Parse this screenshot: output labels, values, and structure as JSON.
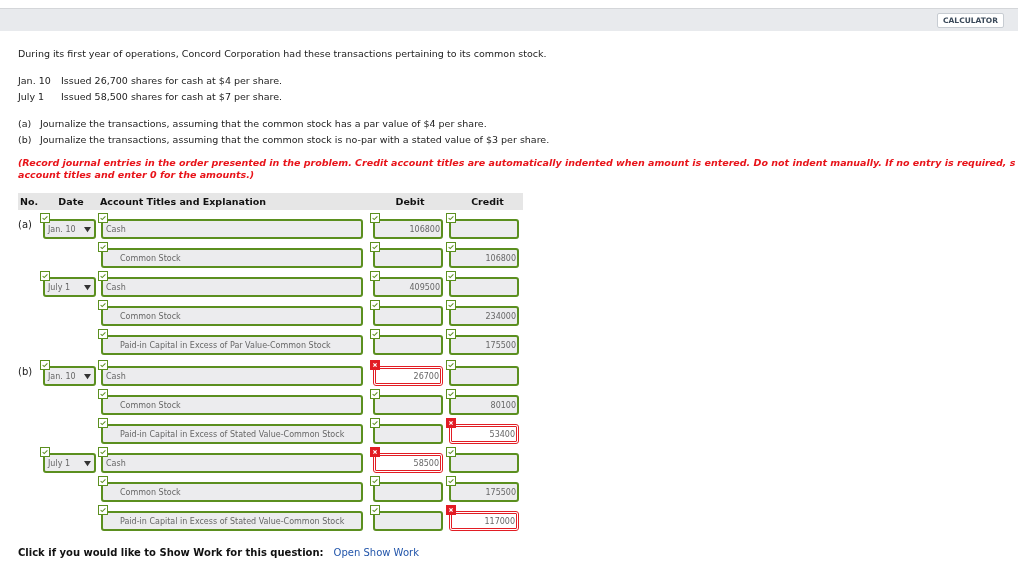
{
  "toolbar": {
    "calculator": "CALCULATOR"
  },
  "intro": "During its first year of operations, Concord Corporation had these transactions pertaining to its common stock.",
  "transactions": [
    {
      "date": "Jan. 10",
      "text": "Issued 26,700 shares for cash at $4 per share."
    },
    {
      "date": "July 1",
      "text": "Issued 58,500 shares for cash at $7 per share."
    }
  ],
  "tasks": [
    {
      "label": "(a)",
      "text": "Journalize the transactions, assuming that the common stock has a par value of $4 per share."
    },
    {
      "label": "(b)",
      "text": "Journalize the transactions, assuming that the common stock is no-par with a stated value of $3 per share."
    }
  ],
  "instructions": [
    "(Record journal entries in the order presented in the problem. Credit account titles are automatically indented when amount is entered. Do not indent manually. If no entry is required, s",
    "account titles and enter 0 for the amounts.)"
  ],
  "table": {
    "columns": [
      "No.",
      "Date",
      "Account Titles and Explanation",
      "Debit",
      "Credit"
    ],
    "rows": [
      {
        "part": "(a)",
        "date": {
          "value": "Jan. 10",
          "correct": true
        },
        "account": {
          "value": "Cash",
          "correct": true,
          "indented": false
        },
        "debit": {
          "value": "106800",
          "correct": true
        },
        "credit": {
          "correct": true
        }
      },
      {
        "account": {
          "value": "Common Stock",
          "correct": true,
          "indented": true
        },
        "debit": {
          "correct": true
        },
        "credit": {
          "value": "106800",
          "correct": true
        }
      },
      {
        "date": {
          "value": "July 1",
          "correct": true
        },
        "account": {
          "value": "Cash",
          "correct": true,
          "indented": false
        },
        "debit": {
          "value": "409500",
          "correct": true
        },
        "credit": {
          "correct": true
        }
      },
      {
        "account": {
          "value": "Common Stock",
          "correct": true,
          "indented": true
        },
        "debit": {
          "correct": true
        },
        "credit": {
          "value": "234000",
          "correct": true
        }
      },
      {
        "account": {
          "value": "Paid-in Capital in Excess of Par Value-Common Stock",
          "correct": true,
          "indented": true
        },
        "debit": {
          "correct": true
        },
        "credit": {
          "value": "175500",
          "correct": true
        }
      },
      {
        "part": "(b)",
        "date": {
          "value": "Jan. 10",
          "correct": true
        },
        "account": {
          "value": "Cash",
          "correct": true,
          "indented": false
        },
        "debit": {
          "value": "26700",
          "correct": false
        },
        "credit": {
          "correct": true
        }
      },
      {
        "account": {
          "value": "Common Stock",
          "correct": true,
          "indented": true
        },
        "debit": {
          "correct": true
        },
        "credit": {
          "value": "80100",
          "correct": true
        }
      },
      {
        "account": {
          "value": "Paid-in Capital in Excess of Stated Value-Common Stock",
          "correct": true,
          "indented": true
        },
        "debit": {
          "correct": true
        },
        "credit": {
          "value": "53400",
          "correct": false
        }
      },
      {
        "date": {
          "value": "July 1",
          "correct": true
        },
        "account": {
          "value": "Cash",
          "correct": true,
          "indented": false
        },
        "debit": {
          "value": "58500",
          "correct": false
        },
        "credit": {
          "correct": true
        }
      },
      {
        "account": {
          "value": "Common Stock",
          "correct": true,
          "indented": true
        },
        "debit": {
          "correct": true
        },
        "credit": {
          "value": "175500",
          "correct": true
        }
      },
      {
        "account": {
          "value": "Paid-in Capital in Excess of Stated Value-Common Stock",
          "correct": true,
          "indented": true
        },
        "debit": {
          "correct": true
        },
        "credit": {
          "value": "117000",
          "correct": false
        }
      }
    ]
  },
  "show_work": {
    "prompt": "Click if you would like to Show Work for this question:",
    "link": "Open Show Work"
  }
}
